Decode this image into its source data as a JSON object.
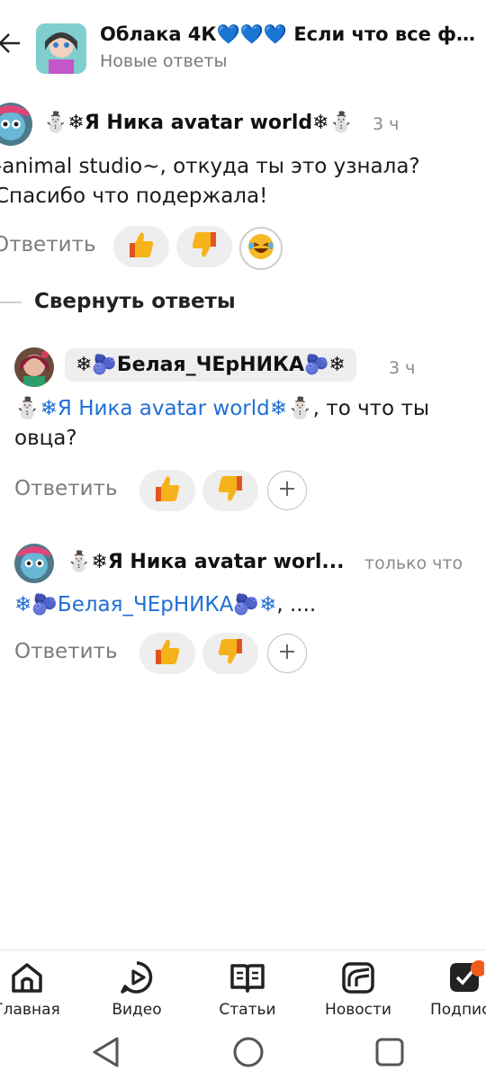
{
  "header": {
    "title": "Облака 4К💙💙💙 Если что все фо...",
    "subtitle": "Новые ответы"
  },
  "comments": [
    {
      "author": "⛄❄Я Ника avatar world❄⛄",
      "time": "3 ч",
      "text": "-animal studio~, откуда ты это узнала? Спасибо что подержала!",
      "reply_label": "Ответить"
    },
    {
      "author": "❄🫐Белая_ЧЕрНИКА🫐❄",
      "time": "3 ч",
      "mention": "⛄❄Я Ника avatar world❄⛄",
      "text": ", то что ты овца?",
      "reply_label": "Ответить"
    },
    {
      "author": "⛄❄Я Ника avatar worl...",
      "time": "только что",
      "mention": "❄🫐Белая_ЧЕрНИКА🫐❄",
      "text": ", ....",
      "reply_label": "Ответить"
    }
  ],
  "collapse_label": "Свернуть ответы",
  "nav": [
    {
      "label": "Главная",
      "icon": "home-icon"
    },
    {
      "label": "Видео",
      "icon": "video-icon"
    },
    {
      "label": "Статьи",
      "icon": "articles-icon"
    },
    {
      "label": "Новости",
      "icon": "news-icon"
    },
    {
      "label": "Подпис",
      "icon": "subscriptions-icon"
    }
  ],
  "colors": {
    "mention": "#1f6fd6",
    "thumb": "#f6b21b",
    "thumb_accent": "#e2541c"
  }
}
